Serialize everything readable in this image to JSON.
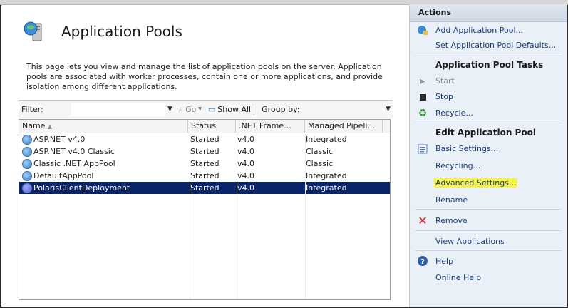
{
  "page": {
    "title": "Application Pools",
    "description": "This page lets you view and manage the list of application pools on the server. Application pools are associated with worker processes, contain one or more applications, and provide isolation among different applications."
  },
  "toolbar": {
    "filter_label": "Filter:",
    "go_label": "Go",
    "show_all_label": "Show All",
    "group_by_label": "Group by:"
  },
  "table": {
    "columns": [
      "Name",
      "Status",
      ".NET Frame...",
      "Managed Pipeli..."
    ],
    "rows": [
      {
        "name": "ASP.NET v4.0",
        "status": "Started",
        "net": "v4.0",
        "pipeline": "Integrated"
      },
      {
        "name": "ASP.NET v4.0 Classic",
        "status": "Started",
        "net": "v4.0",
        "pipeline": "Classic"
      },
      {
        "name": "Classic .NET AppPool",
        "status": "Started",
        "net": "v4.0",
        "pipeline": "Classic"
      },
      {
        "name": "DefaultAppPool",
        "status": "Started",
        "net": "v4.0",
        "pipeline": "Integrated"
      },
      {
        "name": "PolarisClientDeployment",
        "status": "Started",
        "net": "v4.0",
        "pipeline": "Integrated"
      }
    ]
  },
  "actions": {
    "header": "Actions",
    "add_pool": "Add Application Pool...",
    "set_defaults": "Set Application Pool Defaults...",
    "tasks_title": "Application Pool Tasks",
    "start": "Start",
    "stop": "Stop",
    "recycle": "Recycle...",
    "edit_title": "Edit Application Pool",
    "basic_settings": "Basic Settings...",
    "recycling": "Recycling...",
    "advanced_settings": "Advanced Settings...",
    "rename": "Rename",
    "remove": "Remove",
    "view_apps": "View Applications",
    "help": "Help",
    "online_help": "Online Help"
  },
  "colors": {
    "selection": "#0a246a",
    "highlight": "#f6f246",
    "link": "#1a3d7a",
    "remove_red": "#d42020"
  }
}
